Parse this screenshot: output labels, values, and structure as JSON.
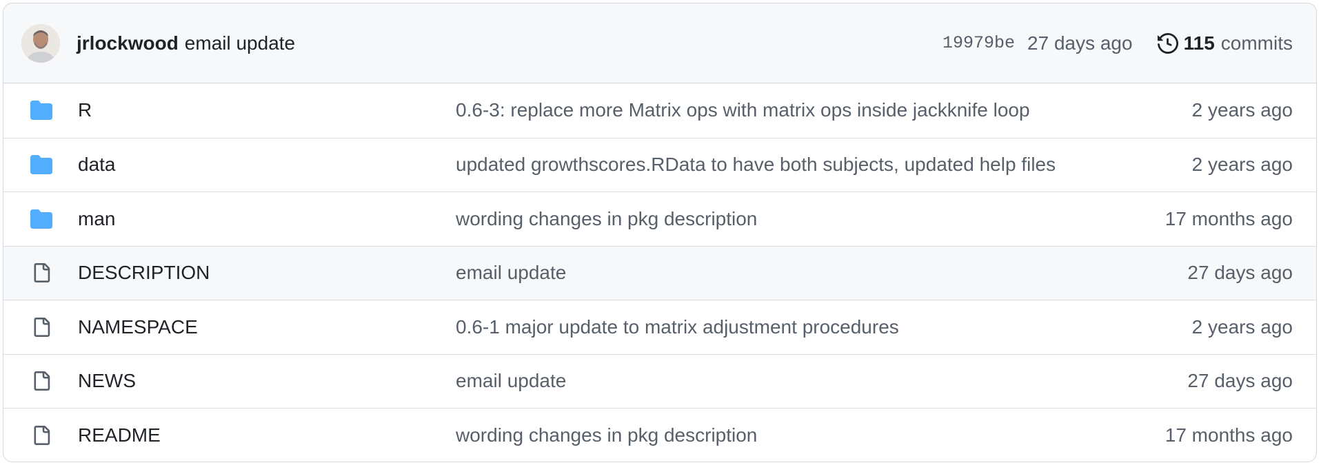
{
  "latest_commit": {
    "author": "jrlockwood",
    "message": "email update",
    "sha": "19979be",
    "age": "27 days ago",
    "commit_count": "115",
    "commits_label": "commits"
  },
  "files": [
    {
      "type": "folder",
      "name": "R",
      "message": "0.6-3: replace more Matrix ops with matrix ops inside jackknife loop",
      "age": "2 years ago"
    },
    {
      "type": "folder",
      "name": "data",
      "message": "updated growthscores.RData to have both subjects, updated help files",
      "age": "2 years ago"
    },
    {
      "type": "folder",
      "name": "man",
      "message": "wording changes in pkg description",
      "age": "17 months ago"
    },
    {
      "type": "file",
      "name": "DESCRIPTION",
      "message": "email update",
      "age": "27 days ago"
    },
    {
      "type": "file",
      "name": "NAMESPACE",
      "message": "0.6-1 major update to matrix adjustment procedures",
      "age": "2 years ago"
    },
    {
      "type": "file",
      "name": "NEWS",
      "message": "email update",
      "age": "27 days ago"
    },
    {
      "type": "file",
      "name": "README",
      "message": "wording changes in pkg description",
      "age": "17 months ago"
    }
  ],
  "colors": {
    "folder": "#54aeff",
    "file_icon": "#57606a",
    "header_bg": "#f6f8fa",
    "highlight_row_bg": "#f6f8fa"
  },
  "icons": {
    "folder": "folder-icon",
    "file": "file-icon",
    "history": "history-icon"
  }
}
